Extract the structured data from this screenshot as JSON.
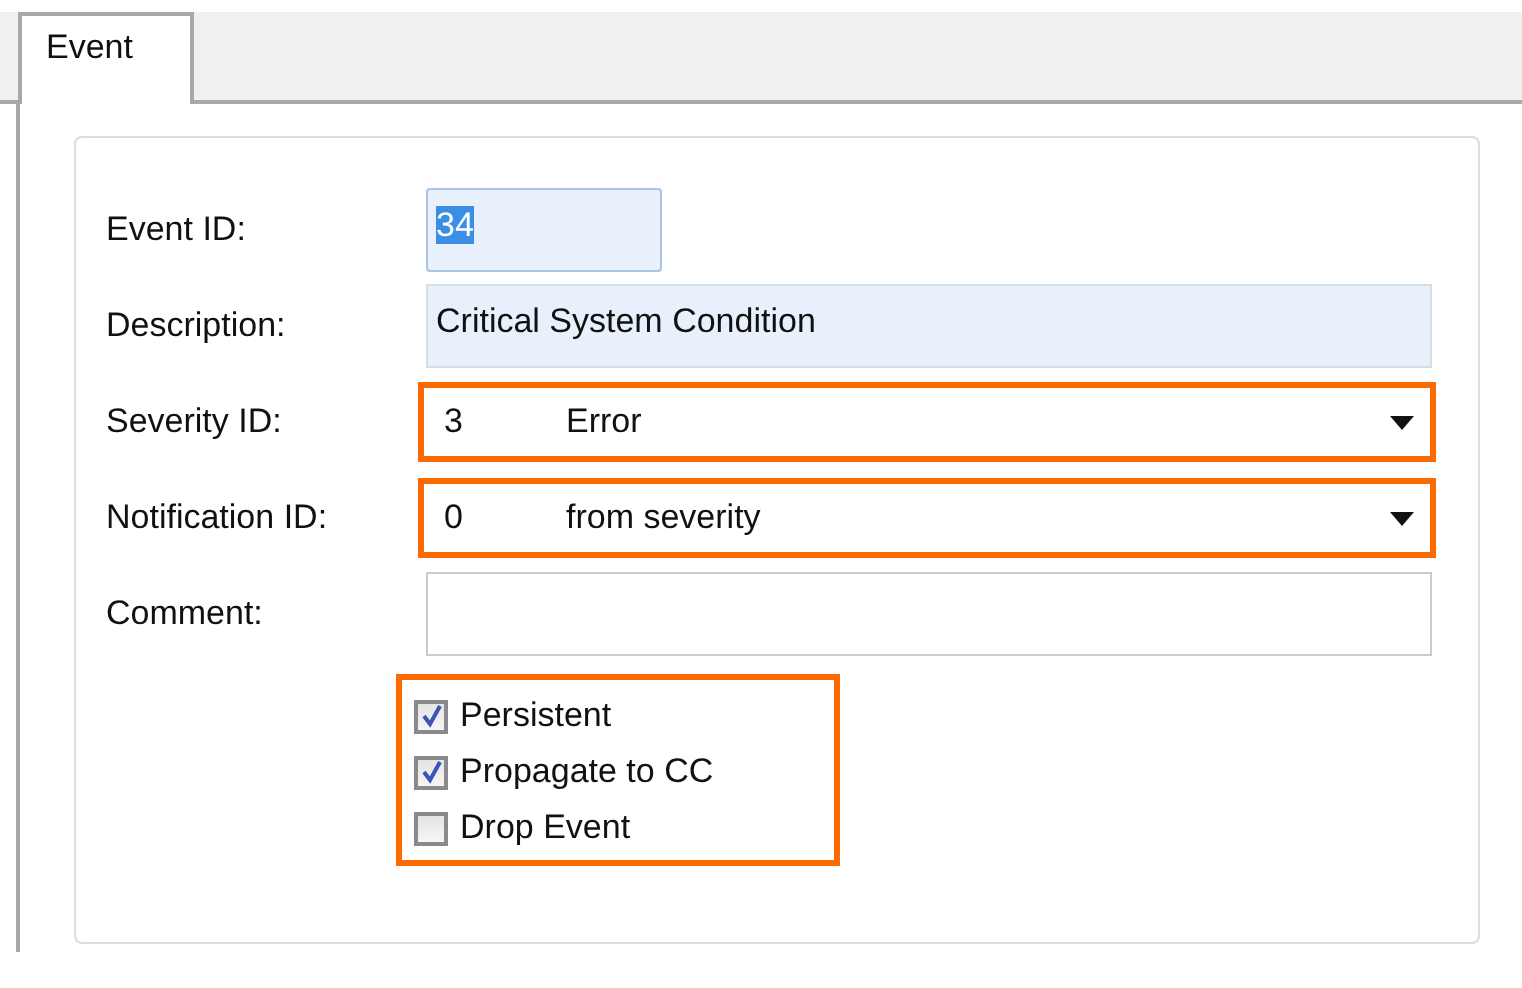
{
  "tabs": [
    {
      "label": "Event",
      "selected": true
    }
  ],
  "fields": [
    {
      "kind": "id",
      "label": "Event ID:",
      "value": "34",
      "value_selected": true
    },
    {
      "kind": "readonly",
      "label": "Description:",
      "value": "Critical System Condition"
    },
    {
      "kind": "dropdown",
      "label": "Severity ID:",
      "code": "3",
      "value": "Error",
      "highlighted": true
    },
    {
      "kind": "dropdown",
      "label": "Notification ID:",
      "code": "0",
      "value": "from severity",
      "highlighted": true
    },
    {
      "kind": "text",
      "label": "Comment:"
    }
  ],
  "checkbox_group": {
    "highlighted": true,
    "items": [
      {
        "label": "Persistent",
        "checked": true
      },
      {
        "label": "Propagate to CC",
        "checked": true
      },
      {
        "label": "Drop Event",
        "checked": false
      }
    ]
  }
}
